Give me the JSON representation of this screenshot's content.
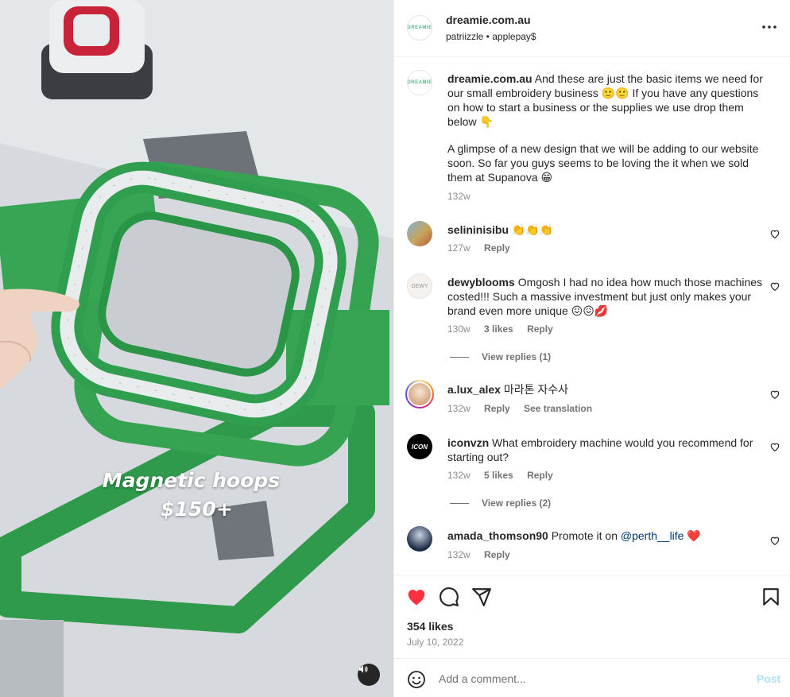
{
  "media": {
    "caption_line1": "Magnetic hoops",
    "caption_line2": "$150+",
    "sound_icon": "speaker-icon"
  },
  "header": {
    "username": "dreamie.com.au",
    "logo_text": "DREAMIE",
    "subtitle": "patriizzle • applepay$",
    "more_icon": "more-horizontal-icon"
  },
  "caption_post": {
    "username": "dreamie.com.au",
    "text_part1": "And these are just the basic items we need for our small embroidery business 🙂🙂 If you have any questions on how to start a business or the supplies we use drop them below 👇",
    "text_part2": "A glimpse of a new design that we will be adding to our website soon. So far you guys seems to be loving the it when we sold them at Supanova 😁",
    "time": "132w"
  },
  "comments": [
    {
      "username": "selininisibu",
      "text": "👏👏👏",
      "time": "127w",
      "likes": "",
      "reply": "Reply"
    },
    {
      "username": "dewyblooms",
      "text": "Omgosh I had no idea how much those machines costed!!! Such a massive investment but just only makes your brand even more unique 😖😖💋",
      "time": "130w",
      "likes": "3 likes",
      "reply": "Reply",
      "view_replies": "View replies (1)",
      "avatar_text": "DEWY"
    },
    {
      "username": "a.lux_alex",
      "text": "마라톤 자수사",
      "time": "132w",
      "likes": "",
      "reply": "Reply",
      "translate": "See translation"
    },
    {
      "username": "iconvzn",
      "text": "What embroidery machine would you recommend for starting out?",
      "time": "132w",
      "likes": "5 likes",
      "reply": "Reply",
      "view_replies": "View replies (2)",
      "avatar_text": "ICON"
    },
    {
      "username": "amada_thomson90",
      "text": "Promote it on",
      "mention": "@perth__life",
      "text_after": "❤️",
      "time": "132w",
      "reply": "Reply"
    }
  ],
  "actions": {
    "likes": "354 likes",
    "date": "July 10, 2022",
    "like_color": "#ff3040"
  },
  "add_comment": {
    "placeholder": "Add a comment...",
    "post_label": "Post"
  }
}
